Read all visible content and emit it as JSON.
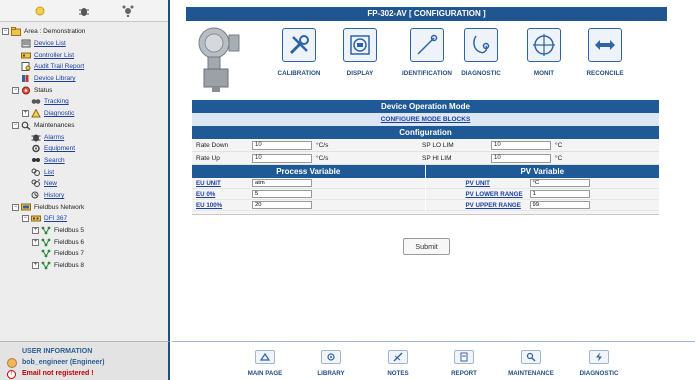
{
  "sidebar": {
    "tree": [
      {
        "label": "Area : Demonstration",
        "toggle": "⊟",
        "icon": "area-icon",
        "indent": 0,
        "style": "plain"
      },
      {
        "label": "Device List",
        "toggle": "",
        "icon": "device-list-icon",
        "indent": 1,
        "style": "link"
      },
      {
        "label": "Controller List",
        "toggle": "",
        "icon": "controller-list-icon",
        "indent": 1,
        "style": "link"
      },
      {
        "label": "Audit Trail Report",
        "toggle": "",
        "icon": "audit-trail-icon",
        "indent": 1,
        "style": "link"
      },
      {
        "label": "Device Library",
        "toggle": "",
        "icon": "device-library-icon",
        "indent": 1,
        "style": "link"
      },
      {
        "label": "Status",
        "toggle": "⊟",
        "icon": "status-icon",
        "indent": 1,
        "style": "plain"
      },
      {
        "label": "Tracking",
        "toggle": "",
        "icon": "tracking-icon",
        "indent": 2,
        "style": "link"
      },
      {
        "label": "Diagnostic",
        "toggle": "⊞",
        "icon": "diagnostic-icon",
        "indent": 2,
        "style": "link"
      },
      {
        "label": "Maintenances",
        "toggle": "⊟",
        "icon": "maintenances-icon",
        "indent": 1,
        "style": "plain"
      },
      {
        "label": "Alarms",
        "toggle": "",
        "icon": "alarms-icon",
        "indent": 2,
        "style": "link"
      },
      {
        "label": "Equipment",
        "toggle": "",
        "icon": "equipment-icon",
        "indent": 2,
        "style": "link"
      },
      {
        "label": "Search",
        "toggle": "",
        "icon": "search-icon",
        "indent": 2,
        "style": "link"
      },
      {
        "label": "List",
        "toggle": "",
        "icon": "list-icon",
        "indent": 2,
        "style": "link"
      },
      {
        "label": "New",
        "toggle": "",
        "icon": "new-icon",
        "indent": 2,
        "style": "link"
      },
      {
        "label": "History",
        "toggle": "",
        "icon": "history-icon",
        "indent": 2,
        "style": "link"
      },
      {
        "label": "Fieldbus Network",
        "toggle": "⊟",
        "icon": "network-icon",
        "indent": 1,
        "style": "plain"
      },
      {
        "label": "DFI 367",
        "toggle": "⊟",
        "icon": "dfi-icon",
        "indent": 2,
        "style": "link"
      },
      {
        "label": "Fieldbus 5",
        "toggle": "⊞",
        "icon": "fieldbus-icon",
        "indent": 3,
        "style": "plain"
      },
      {
        "label": "Fieldbus 6",
        "toggle": "⊞",
        "icon": "fieldbus-icon",
        "indent": 3,
        "style": "plain"
      },
      {
        "label": "Fieldbus 7",
        "toggle": "",
        "icon": "fieldbus-icon",
        "indent": 3,
        "style": "plain"
      },
      {
        "label": "Fieldbus 8",
        "toggle": "⊞",
        "icon": "fieldbus-icon",
        "indent": 3,
        "style": "plain"
      }
    ],
    "user": {
      "title": "USER INFORMATION",
      "name": "bob_engineer (Engineer)",
      "warning": "Email not registered !"
    }
  },
  "header": {
    "title": "FP-302-AV [ CONFIGURATION ]"
  },
  "tools": [
    {
      "label": "CALIBRATION",
      "icon": "calibration-icon"
    },
    {
      "label": "DISPLAY",
      "icon": "display-icon"
    },
    {
      "label": "IDENTIFICATION",
      "icon": "identification-icon"
    },
    {
      "label": "DIAGNOSTIC",
      "icon": "diagnostic-tool-icon"
    },
    {
      "label": "MONIT",
      "icon": "monitor-icon"
    },
    {
      "label": "RECONCILE",
      "icon": "reconcile-icon"
    }
  ],
  "operation_mode": {
    "title": "Device Operation Mode",
    "link": "CONFIGURE MODE BLOCKS"
  },
  "configuration": {
    "title": "Configuration",
    "rate_down": {
      "label": "Rate Down",
      "value": "10",
      "unit": "°C/s"
    },
    "rate_up": {
      "label": "Rate Up",
      "value": "10",
      "unit": "°C/s"
    },
    "sp_lo_lim": {
      "label": "SP LO LIM",
      "value": "10",
      "unit": "°C"
    },
    "sp_hi_lim": {
      "label": "SP HI LIM",
      "value": "10",
      "unit": "°C"
    }
  },
  "process_variable": {
    "title": "Process Variable",
    "eu_unit": {
      "label": "EU UNIT",
      "value": "atm"
    },
    "eu_0": {
      "label": "EU 0%",
      "value": "5"
    },
    "eu_100": {
      "label": "EU 100%",
      "value": "20"
    }
  },
  "pv_variable": {
    "title": "PV Variable",
    "pv_unit": {
      "label": "PV UNIT",
      "value": "°C"
    },
    "pv_lower": {
      "label": "PV LOWER RANGE",
      "value": "1"
    },
    "pv_upper": {
      "label": "PV UPPER RANGE",
      "value": "99"
    }
  },
  "submit_label": "Submit",
  "bottom_nav": [
    {
      "label": "MAIN PAGE",
      "icon": "main-page-icon"
    },
    {
      "label": "LIBRARY",
      "icon": "library-icon"
    },
    {
      "label": "NOTES",
      "icon": "notes-icon"
    },
    {
      "label": "REPORT",
      "icon": "report-icon"
    },
    {
      "label": "MAINTENANCE",
      "icon": "maintenance-icon"
    },
    {
      "label": "DIAGNOSTIC",
      "icon": "diagnostic-nav-icon"
    }
  ],
  "colors": {
    "accent": "#1f5590",
    "link": "#1a3fa0",
    "warning": "#c00000"
  }
}
